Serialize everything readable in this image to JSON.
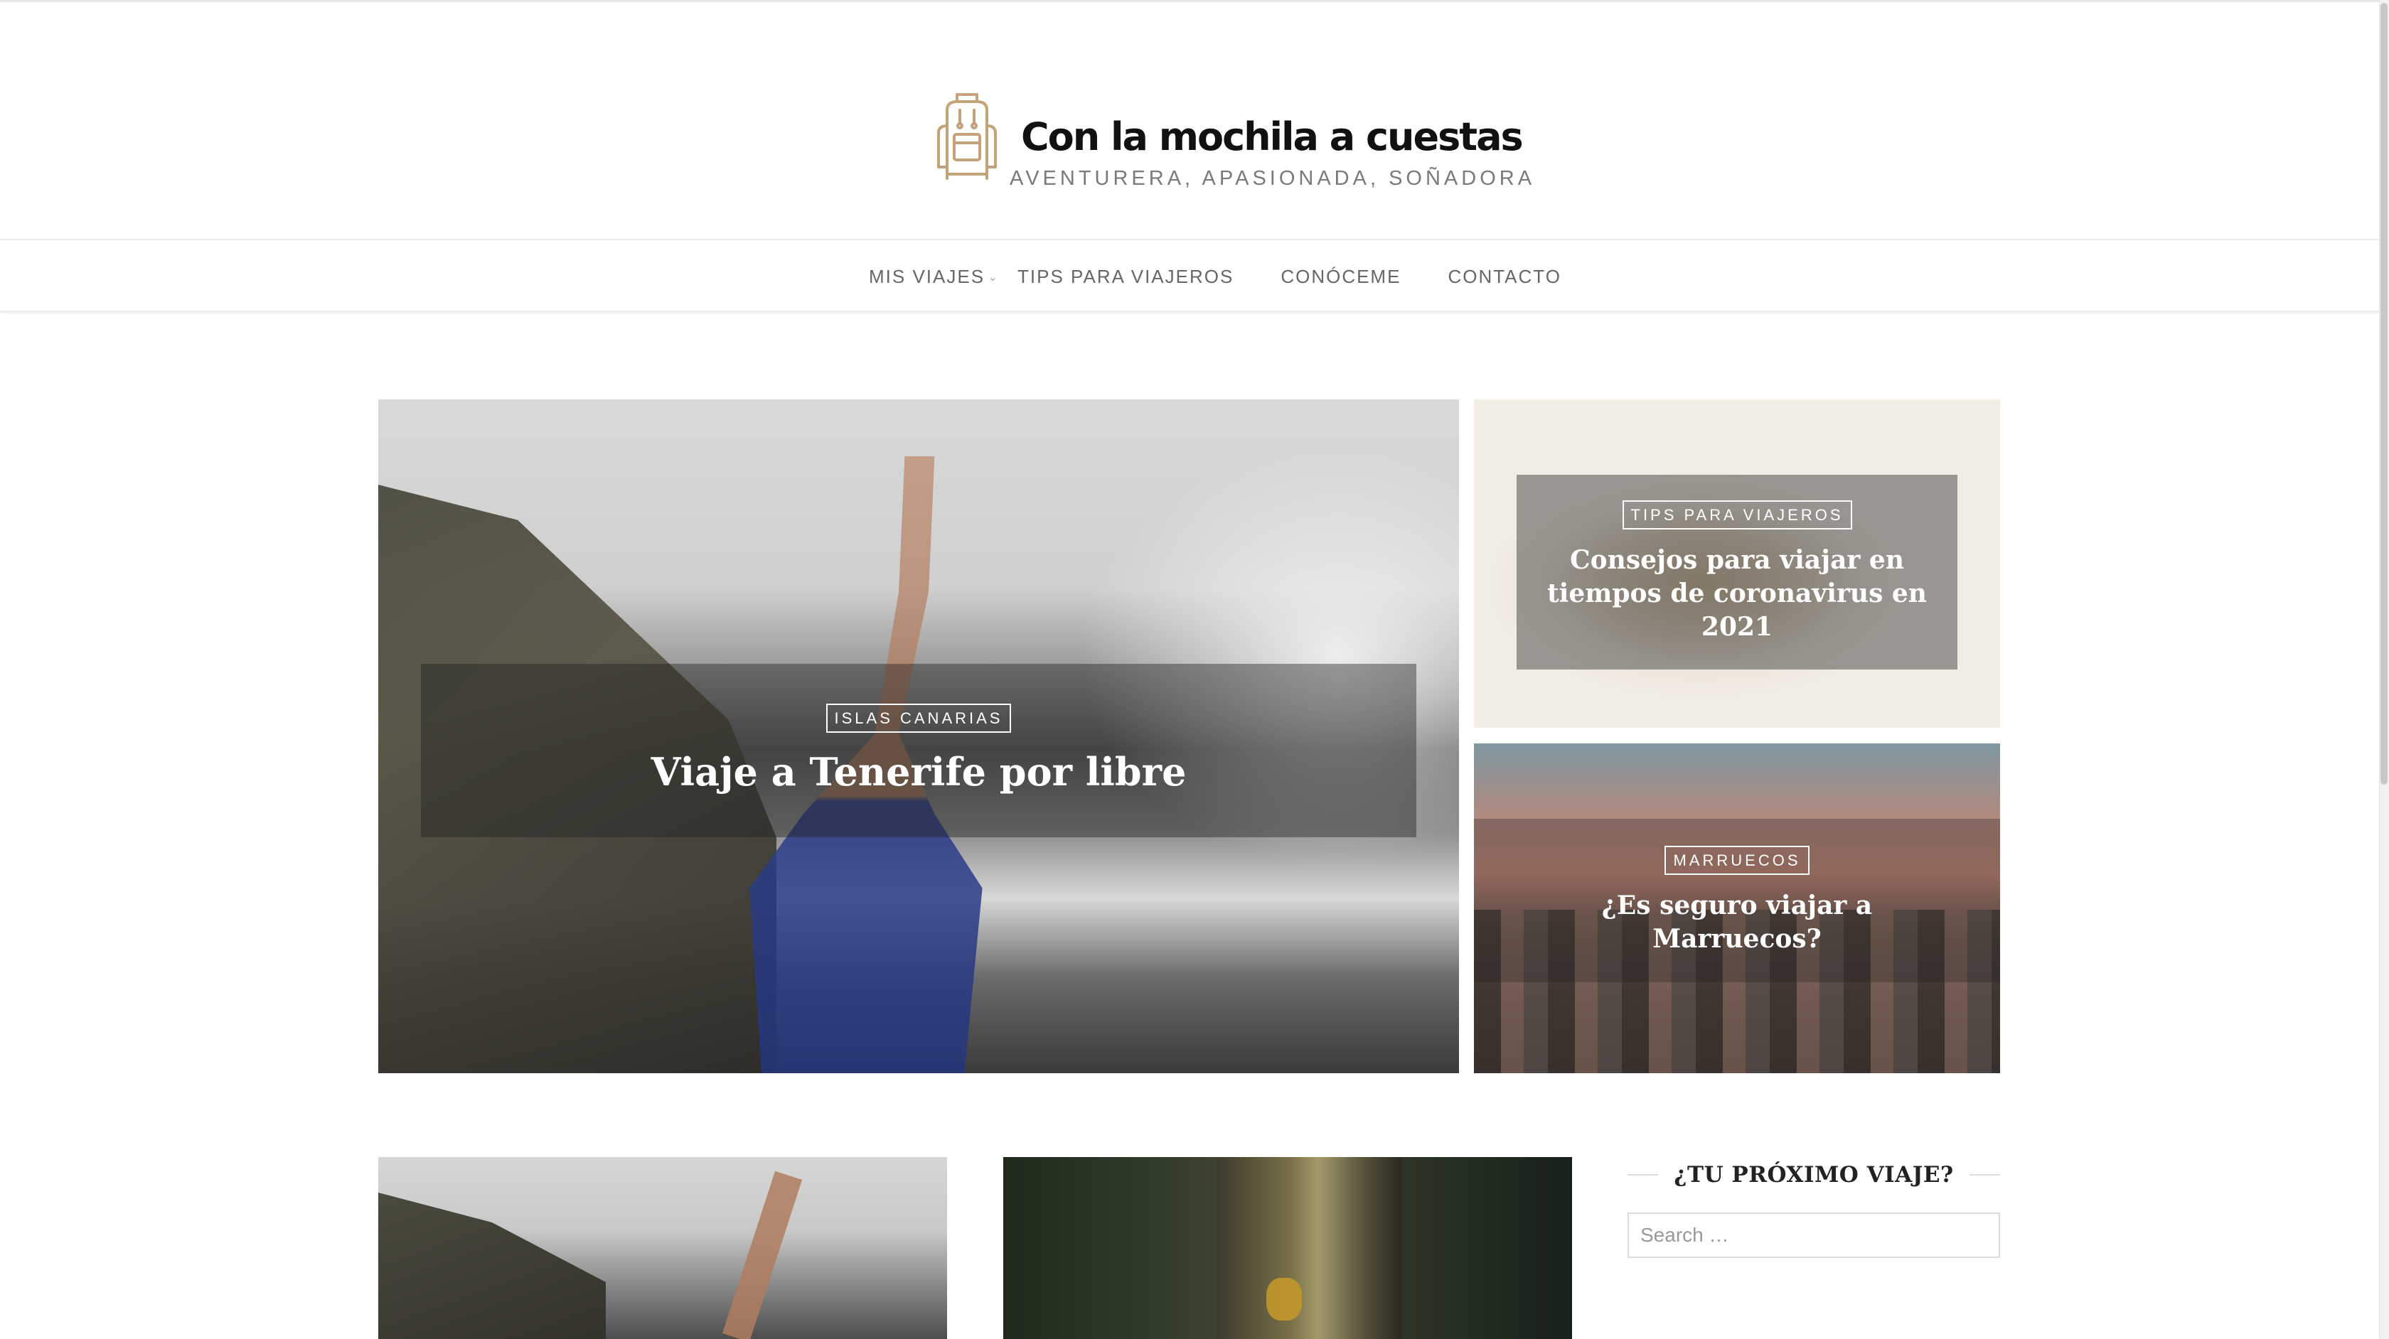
{
  "site": {
    "title": "Con la mochila a cuestas",
    "tagline": "AVENTURERA, APASIONADA, SOÑADORA",
    "logo_icon": "backpack-icon",
    "accent_color": "#c4a27a"
  },
  "nav": {
    "items": [
      {
        "label": "MIS VIAJES"
      },
      {
        "label": "TIPS PARA VIAJEROS"
      },
      {
        "label": "CONÓCEME"
      },
      {
        "label": "CONTACTO"
      }
    ],
    "dropdown_icon": "chevron-down-icon"
  },
  "featured": [
    {
      "category": "ISLAS CANARIAS",
      "title": "Viaje a Tenerife por libre"
    },
    {
      "category": "TIPS PARA VIAJEROS",
      "title": "Consejos para viajar en tiempos de coronavirus en 2021"
    },
    {
      "category": "MARRUECOS",
      "title": "¿Es seguro viajar a Marruecos?"
    }
  ],
  "sidebar": {
    "widget_title": "¿TU PRÓXIMO VIAJE?",
    "search_placeholder": "Search …"
  }
}
